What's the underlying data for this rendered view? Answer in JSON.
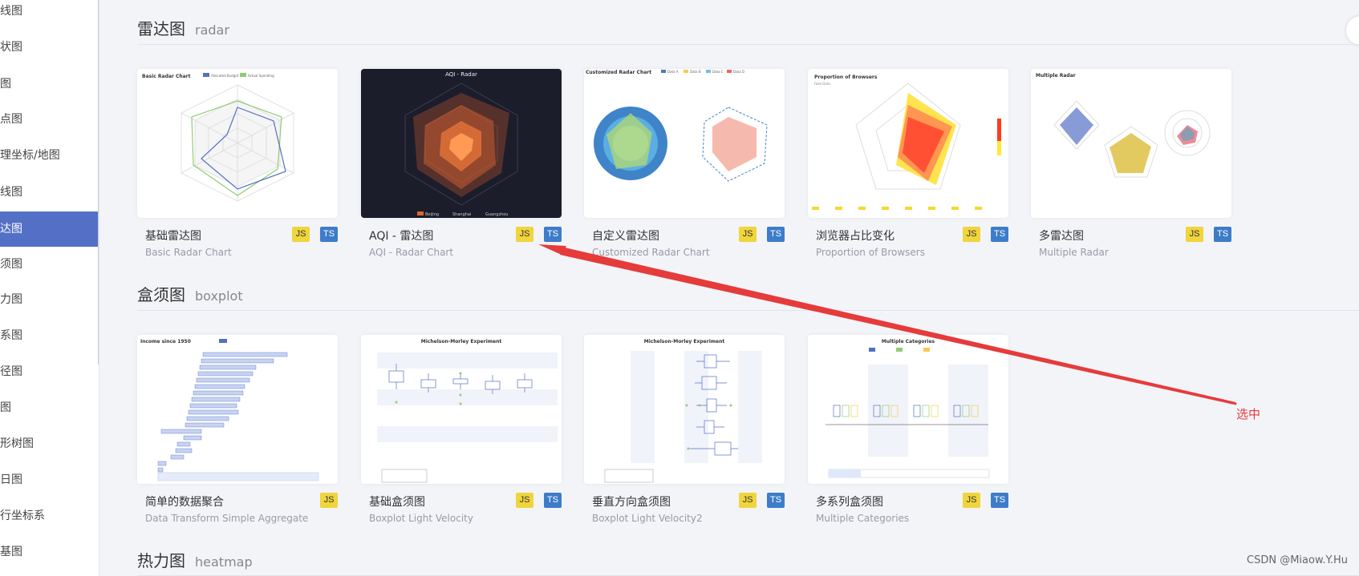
{
  "sidebar": {
    "items": [
      {
        "label": "线图",
        "active": false
      },
      {
        "label": "状图",
        "active": false
      },
      {
        "label": "图",
        "active": false
      },
      {
        "label": "点图",
        "active": false
      },
      {
        "label": "理坐标/地图",
        "active": false
      },
      {
        "label": "线图",
        "active": false
      },
      {
        "label": "达图",
        "active": true
      },
      {
        "label": "须图",
        "active": false
      },
      {
        "label": "力图",
        "active": false
      },
      {
        "label": "系图",
        "active": false
      },
      {
        "label": "径图",
        "active": false
      },
      {
        "label": "图",
        "active": false
      },
      {
        "label": "形树图",
        "active": false
      },
      {
        "label": "日图",
        "active": false
      },
      {
        "label": "行坐标系",
        "active": false
      },
      {
        "label": "基图",
        "active": false
      }
    ]
  },
  "sections": {
    "radar": {
      "title_zh": "雷达图",
      "title_en": "radar"
    },
    "boxplot": {
      "title_zh": "盒须图",
      "title_en": "boxplot"
    },
    "heatmap": {
      "title_zh": "热力图",
      "title_en": "heatmap"
    }
  },
  "badges": {
    "js": "JS",
    "ts": "TS"
  },
  "radar_cards": [
    {
      "title": "基础雷达图",
      "subtitle": "Basic Radar Chart",
      "ts": true
    },
    {
      "title": "AQI - 雷达图",
      "subtitle": "AQI - Radar Chart",
      "ts": true
    },
    {
      "title": "自定义雷达图",
      "subtitle": "Customized Radar Chart",
      "ts": true
    },
    {
      "title": "浏览器占比变化",
      "subtitle": "Proportion of Browsers",
      "ts": true
    },
    {
      "title": "多雷达图",
      "subtitle": "Multiple Radar",
      "ts": true
    }
  ],
  "boxplot_cards": [
    {
      "title": "简单的数据聚合",
      "subtitle": "Data Transform Simple Aggregate",
      "ts": false
    },
    {
      "title": "基础盒须图",
      "subtitle": "Boxplot Light Velocity",
      "ts": true
    },
    {
      "title": "垂直方向盒须图",
      "subtitle": "Boxplot Light Velocity2",
      "ts": true
    },
    {
      "title": "多系列盒须图",
      "subtitle": "Multiple Categories",
      "ts": true
    }
  ],
  "thumbs": {
    "basic_radar": {
      "title": "Basic Radar Chart",
      "legend": [
        "Allocated Budget",
        "Actual Spending"
      ]
    },
    "aqi_radar": {
      "title": "AQI - Radar",
      "legend": [
        "Beijing",
        "Shanghai",
        "Guangzhou"
      ]
    },
    "custom_radar": {
      "title": "Customized Radar Chart",
      "legend": [
        "Data A",
        "Data B",
        "Data C",
        "Data D"
      ]
    },
    "browsers": {
      "title": "Proportion of Browsers",
      "subtitle": "Fake Data"
    },
    "multi_radar": {
      "title": "Multiple Radar"
    },
    "income": {
      "title": "Income since 1950"
    },
    "michelson1": {
      "title": "Michelson-Morley Experiment"
    },
    "michelson2": {
      "title": "Michelson-Morley Experiment"
    },
    "multi_cat": {
      "title": "Multiple Categories"
    }
  },
  "annotation": {
    "label": "选中",
    "color": "#e53b3b"
  },
  "watermark": "CSDN @Miaow.Y.Hu",
  "colors": {
    "accent": "#5470c6",
    "js_badge": "#f0d53c",
    "ts_badge": "#3d7cc9"
  }
}
